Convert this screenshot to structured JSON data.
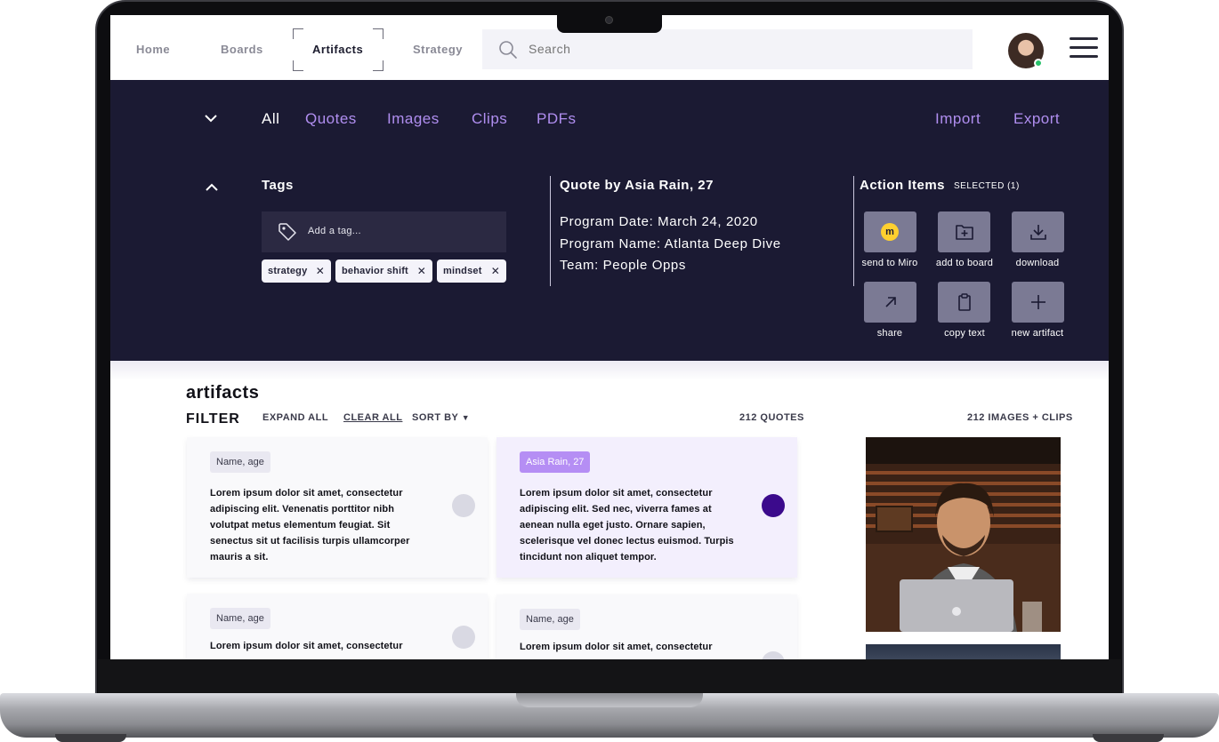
{
  "nav": {
    "items": [
      "Home",
      "Boards",
      "Artifacts",
      "Strategy"
    ],
    "active": "Artifacts",
    "search_placeholder": "Search"
  },
  "filter_tabs": [
    "All",
    "Quotes",
    "Images",
    "Clips",
    "PDFs"
  ],
  "top_actions": {
    "import": "Import",
    "export": "Export"
  },
  "tags": {
    "title": "Tags",
    "placeholder": "Add a tag...",
    "chips": [
      "strategy",
      "behavior shift",
      "mindset"
    ]
  },
  "quote": {
    "title": "Quote by Asia Rain, 27",
    "program_date": "Program Date: March 24, 2020",
    "program_name": "Program Name: Atlanta Deep Dive",
    "team": "Team: People Opps"
  },
  "action_items": {
    "title": "Action Items",
    "selected": "SELECTED (1)",
    "buttons": [
      "send to Miro",
      "add to board",
      "download",
      "share",
      "copy text",
      "new artifact"
    ]
  },
  "artifacts": {
    "heading": "artifacts",
    "filter": "FILTER",
    "expand_all": "EXPAND ALL",
    "clear_all": "CLEAR ALL",
    "sort_by": "SORT BY",
    "quotes_count": "212 QUOTES",
    "images_count": "212 IMAGES + CLIPS"
  },
  "cards": [
    {
      "tag": "Name, age",
      "text": "Lorem ipsum dolor sit amet, consectetur adipiscing elit. Venenatis porttitor nibh volutpat metus elementum feugiat. Sit senectus sit ut facilisis turpis ullamcorper mauris a sit.",
      "selected": false
    },
    {
      "tag": "Asia Rain, 27",
      "text": "Lorem ipsum dolor sit amet, consectetur adipiscing elit. Sed nec, viverra fames at aenean nulla eget justo. Ornare sapien, scelerisque vel donec lectus euismod. Turpis tincidunt non aliquet tempor.",
      "selected": true
    },
    {
      "tag": "Name, age",
      "text": "Lorem ipsum dolor sit amet, consectetur",
      "selected": false
    },
    {
      "tag": "Name, age",
      "text": "Lorem ipsum dolor sit amet, consectetur",
      "selected": false
    }
  ],
  "colors": {
    "panel_bg": "#1b1a33",
    "accent_purple": "#b08ef0",
    "selected_radio": "#3b0a8c",
    "online_dot": "#29c16a"
  }
}
